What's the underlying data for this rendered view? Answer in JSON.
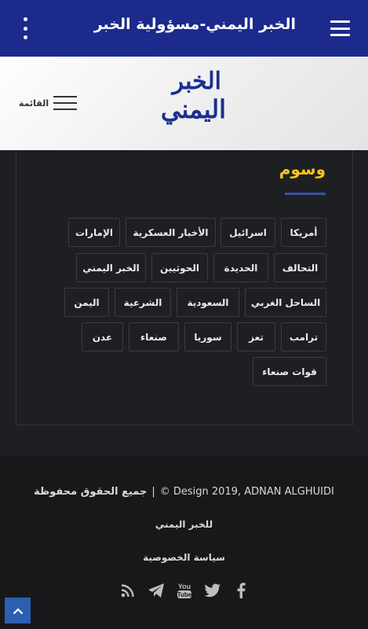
{
  "appbar": {
    "title": "الخبر اليمني-مسؤولية الخبر",
    "menu_icon": "hamburger-icon",
    "overflow_icon": "more-vert-icon"
  },
  "header": {
    "logo_line1": "الخبر",
    "logo_line2": "اليمني",
    "menu_label": "القائمة"
  },
  "tags": {
    "title": "وسوم",
    "items": [
      "أمريكا",
      "اسرائيل",
      "الأخبار العسكرية",
      "الإمارات",
      "التحالف",
      "الحديدة",
      "الحوثيين",
      "الخبر اليمني",
      "الساحل الغربي",
      "السعودية",
      "الشرعية",
      "اليمن",
      "ترامب",
      "تعز",
      "سوريا",
      "صنعاء",
      "عدن",
      "قوات صنعاء"
    ]
  },
  "footer": {
    "copyright": "© Design 2019, ADNAN ALGHUIDI",
    "separator": "|",
    "rights": "جميع الحقوق محفوظة",
    "owner": "للخبر اليمني",
    "privacy": "سياسة الخصوصية",
    "social": [
      "facebook-icon",
      "twitter-icon",
      "youtube-icon",
      "telegram-icon",
      "rss-icon"
    ]
  },
  "colors": {
    "appbar": "#1b2a8c",
    "accent": "#f5c51b",
    "underline": "#3a52a4",
    "background": "#1e1f23",
    "footer": "#18181b",
    "to_top": "#2c5fb0"
  }
}
